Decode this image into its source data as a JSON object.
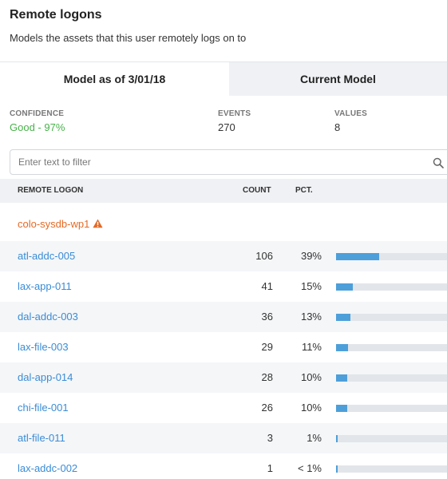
{
  "panel": {
    "title": "Remote logons",
    "subtitle": "Models the assets that this user remotely logs on to"
  },
  "tabs": [
    {
      "label": "Model as of 3/01/18",
      "active": true
    },
    {
      "label": "Current Model",
      "active": false
    }
  ],
  "stats": {
    "confidence": {
      "label": "CONFIDENCE",
      "value": "Good - 97%"
    },
    "events": {
      "label": "EVENTS",
      "value": "270"
    },
    "values": {
      "label": "VALUES",
      "value": "8"
    }
  },
  "filter": {
    "placeholder": "Enter text to filter",
    "value": "",
    "icon": "search-icon"
  },
  "table": {
    "headers": {
      "logon": "REMOTE LOGON",
      "count": "COUNT",
      "pct": "PCT."
    },
    "flagged_row": {
      "name": "colo-sysdb-wp1",
      "icon": "warning-icon"
    },
    "rows": [
      {
        "name": "atl-addc-005",
        "count": "106",
        "pct": "39%",
        "fraction": 0.39
      },
      {
        "name": "lax-app-011",
        "count": "41",
        "pct": "15%",
        "fraction": 0.15
      },
      {
        "name": "dal-addc-003",
        "count": "36",
        "pct": "13%",
        "fraction": 0.13
      },
      {
        "name": "lax-file-003",
        "count": "29",
        "pct": "11%",
        "fraction": 0.11
      },
      {
        "name": "dal-app-014",
        "count": "28",
        "pct": "10%",
        "fraction": 0.1
      },
      {
        "name": "chi-file-001",
        "count": "26",
        "pct": "10%",
        "fraction": 0.1
      },
      {
        "name": "atl-file-011",
        "count": "3",
        "pct": "1%",
        "fraction": 0.01
      },
      {
        "name": "lax-addc-002",
        "count": "1",
        "pct": "< 1%",
        "fraction": 0.004
      }
    ]
  },
  "colors": {
    "link": "#3a8cd6",
    "warning": "#e56924",
    "good": "#47b249",
    "bar_fill": "#4d9fda",
    "bar_track": "#e2e5e9"
  }
}
